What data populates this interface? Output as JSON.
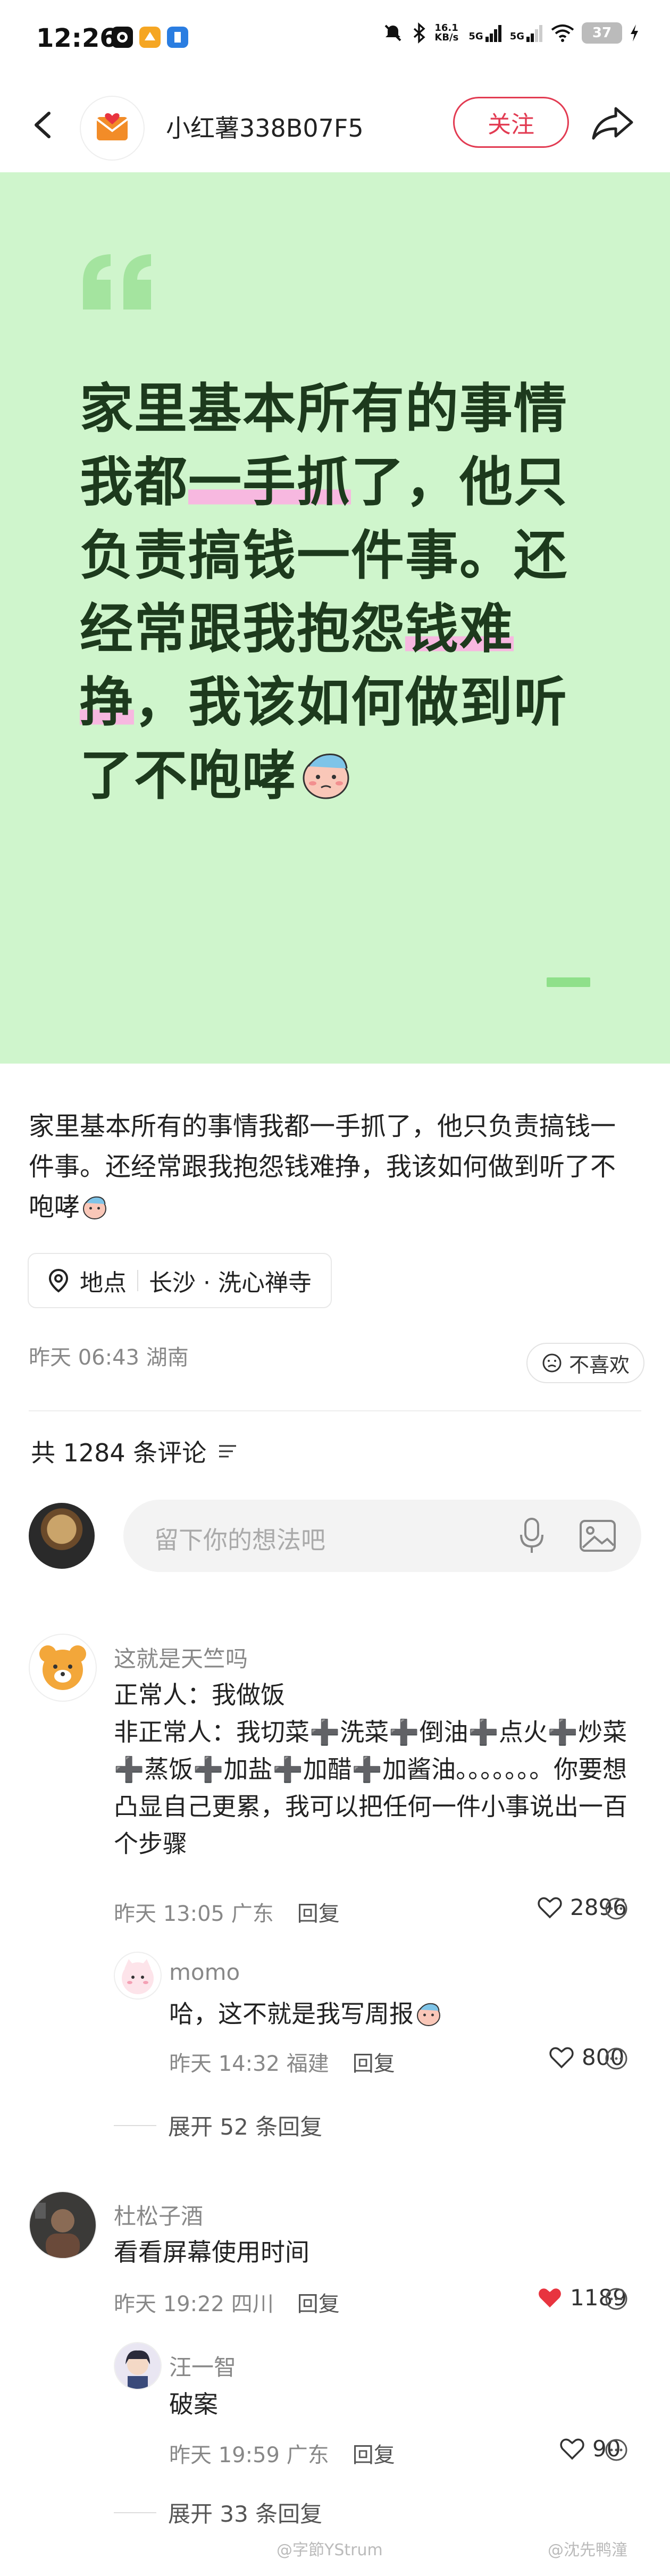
{
  "status_bar": {
    "time": "12:26",
    "net_speed": "16.1 KB/s",
    "signal1": "5G",
    "signal2": "5G",
    "battery": "37"
  },
  "nav": {
    "username": "小红薯338B07F5",
    "follow_label": "关注"
  },
  "card": {
    "line1": "家里基本所有的事情",
    "line2a": "我都",
    "line2b": "一手抓",
    "line2c": "了，他只",
    "line3": "负责搞钱一件事。还",
    "line4a": "经常跟我抱怨",
    "line4b": "钱难",
    "line5a": "挣",
    "line5b": "，我该如何做到听",
    "line6": "了不咆哮",
    "bg_color": "#cff5cc"
  },
  "post": {
    "description": "家里基本所有的事情我都一手抓了，他只负责搞钱一件事。还经常跟我抱怨钱难挣，我该如何做到听了不咆哮",
    "location_label": "地点",
    "location_value": "长沙 · 洗心禅寺",
    "time": "昨天 06:43",
    "region": "湖南",
    "dislike_label": "不喜欢"
  },
  "comments_header": {
    "count_label": "共 1284 条评论"
  },
  "comment_input": {
    "placeholder": "留下你的想法吧"
  },
  "comments": [
    {
      "name": "这就是天竺吗",
      "text": "正常人：我做饭\n非正常人：我切菜➕洗菜➕倒油➕点火➕炒菜➕蒸饭➕加盐➕加醋➕加酱油。。。。。。。你要想凸显自己更累，我可以把任何一件小事说出一百个步骤",
      "time": "昨天 13:05",
      "region": "广东",
      "reply_label": "回复",
      "likes": "2896",
      "reply": {
        "name": "momo",
        "text": "哈，这不就是我写周报",
        "time": "昨天 14:32",
        "region": "福建",
        "reply_label": "回复",
        "likes": "800"
      },
      "expand_label": "展开 52 条回复"
    },
    {
      "name": "杜松子酒",
      "text": "看看屏幕使用时间",
      "time": "昨天 19:22",
      "region": "四川",
      "reply_label": "回复",
      "likes": "1189",
      "reply": {
        "name": "汪一智",
        "text": "破案",
        "time": "昨天 19:59",
        "region": "广东",
        "reply_label": "回复",
        "likes": "90"
      },
      "expand_label": "展开 33 条回复"
    }
  ],
  "watermarks": {
    "left": "@字節YStrum",
    "right": "@沈先鸭潼"
  },
  "colors": {
    "accent": "#e23b52",
    "liked": "#e8343f",
    "highlight": "#f7b8e0"
  }
}
